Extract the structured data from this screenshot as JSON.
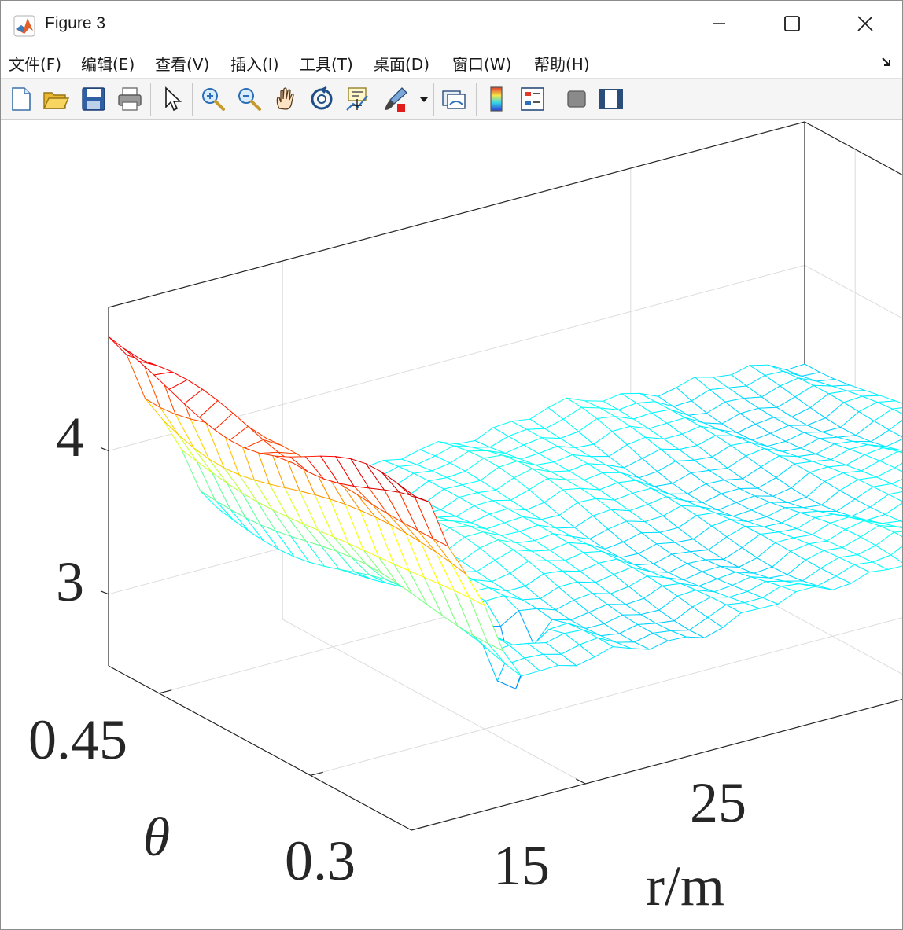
{
  "window": {
    "title": "Figure 3"
  },
  "menu": {
    "items": [
      "文件(F)",
      "编辑(E)",
      "查看(V)",
      "插入(I)",
      "工具(T)",
      "桌面(D)",
      "窗口(W)",
      "帮助(H)"
    ]
  },
  "toolbar": {
    "buttons": [
      "new-figure-icon",
      "open-file-icon",
      "save-icon",
      "print-icon",
      "pointer-icon",
      "zoom-in-icon",
      "zoom-out-icon",
      "pan-hand-icon",
      "rotate-3d-icon",
      "data-cursor-icon",
      "brush-icon",
      "link-plot-icon",
      "colorbar-icon",
      "legend-icon",
      "hide-plot-tools-icon",
      "show-plot-tools-icon"
    ]
  },
  "chart_data": {
    "type": "surface-mesh-3d",
    "title": "",
    "xlabel": "r/m",
    "ylabel": "θ",
    "zlabel": "",
    "xticks": [
      "15",
      "25"
    ],
    "yticks": [
      "0.3",
      "0.45"
    ],
    "zticks": [
      "3",
      "4"
    ],
    "xlim": [
      10,
      30
    ],
    "ylim": [
      0.2,
      0.5
    ],
    "zlim": [
      2.5,
      5.0
    ],
    "grid": true,
    "colormap": "jet",
    "features": {
      "high_ridge_z": 4.7,
      "plateau_z": 3.4,
      "spike_min_z": 2.95,
      "spike_r": 14.6
    }
  }
}
